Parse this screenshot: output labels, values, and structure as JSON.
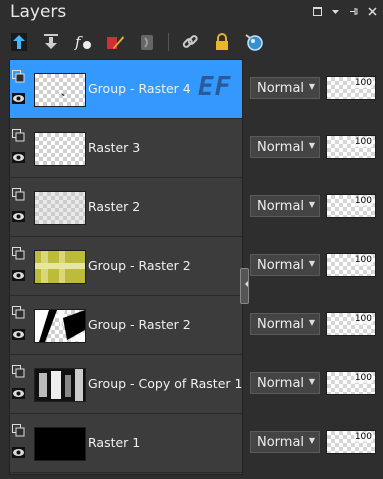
{
  "panel": {
    "title": "Layers"
  },
  "window_controls": [
    {
      "name": "maximize-icon",
      "glyph": "▫"
    },
    {
      "name": "menu-arrow-icon",
      "glyph": "▾"
    },
    {
      "name": "pin-icon",
      "glyph": "⊣"
    },
    {
      "name": "close-icon",
      "glyph": "✕"
    }
  ],
  "toolbar": [
    {
      "name": "move-layer-up-icon",
      "glyph": ""
    },
    {
      "name": "move-layer-down-icon",
      "glyph": ""
    },
    {
      "name": "layer-styles-icon",
      "glyph": ""
    },
    {
      "name": "edit-layer-icon",
      "glyph": ""
    },
    {
      "name": "mask-icon",
      "glyph": ""
    },
    {
      "name": "link-icon",
      "glyph": ""
    },
    {
      "name": "lock-icon",
      "glyph": ""
    },
    {
      "name": "new-layer-icon",
      "glyph": ""
    }
  ],
  "layers": [
    {
      "name": "Group - Raster 4",
      "blend": "Normal",
      "opacity": "100",
      "selected": true,
      "thumb": "group4"
    },
    {
      "name": "Raster 3",
      "blend": "Normal",
      "opacity": "100",
      "selected": false,
      "thumb": "empty"
    },
    {
      "name": "Raster 2",
      "blend": "Normal",
      "opacity": "100",
      "selected": false,
      "thumb": "faint"
    },
    {
      "name": "Group - Raster 2",
      "blend": "Normal",
      "opacity": "100",
      "selected": false,
      "thumb": "yellow"
    },
    {
      "name": "Group - Raster 2",
      "blend": "Normal",
      "opacity": "100",
      "selected": false,
      "thumb": "bw"
    },
    {
      "name": "Group - Copy of Raster 1",
      "blend": "Normal",
      "opacity": "100",
      "selected": false,
      "thumb": "photo"
    },
    {
      "name": "Raster 1",
      "blend": "Normal",
      "opacity": "100",
      "selected": false,
      "thumb": "black"
    }
  ],
  "colors": {
    "selected": "#3399ff",
    "panel": "#2e2e2e"
  },
  "badge": {
    "text": "EF"
  }
}
